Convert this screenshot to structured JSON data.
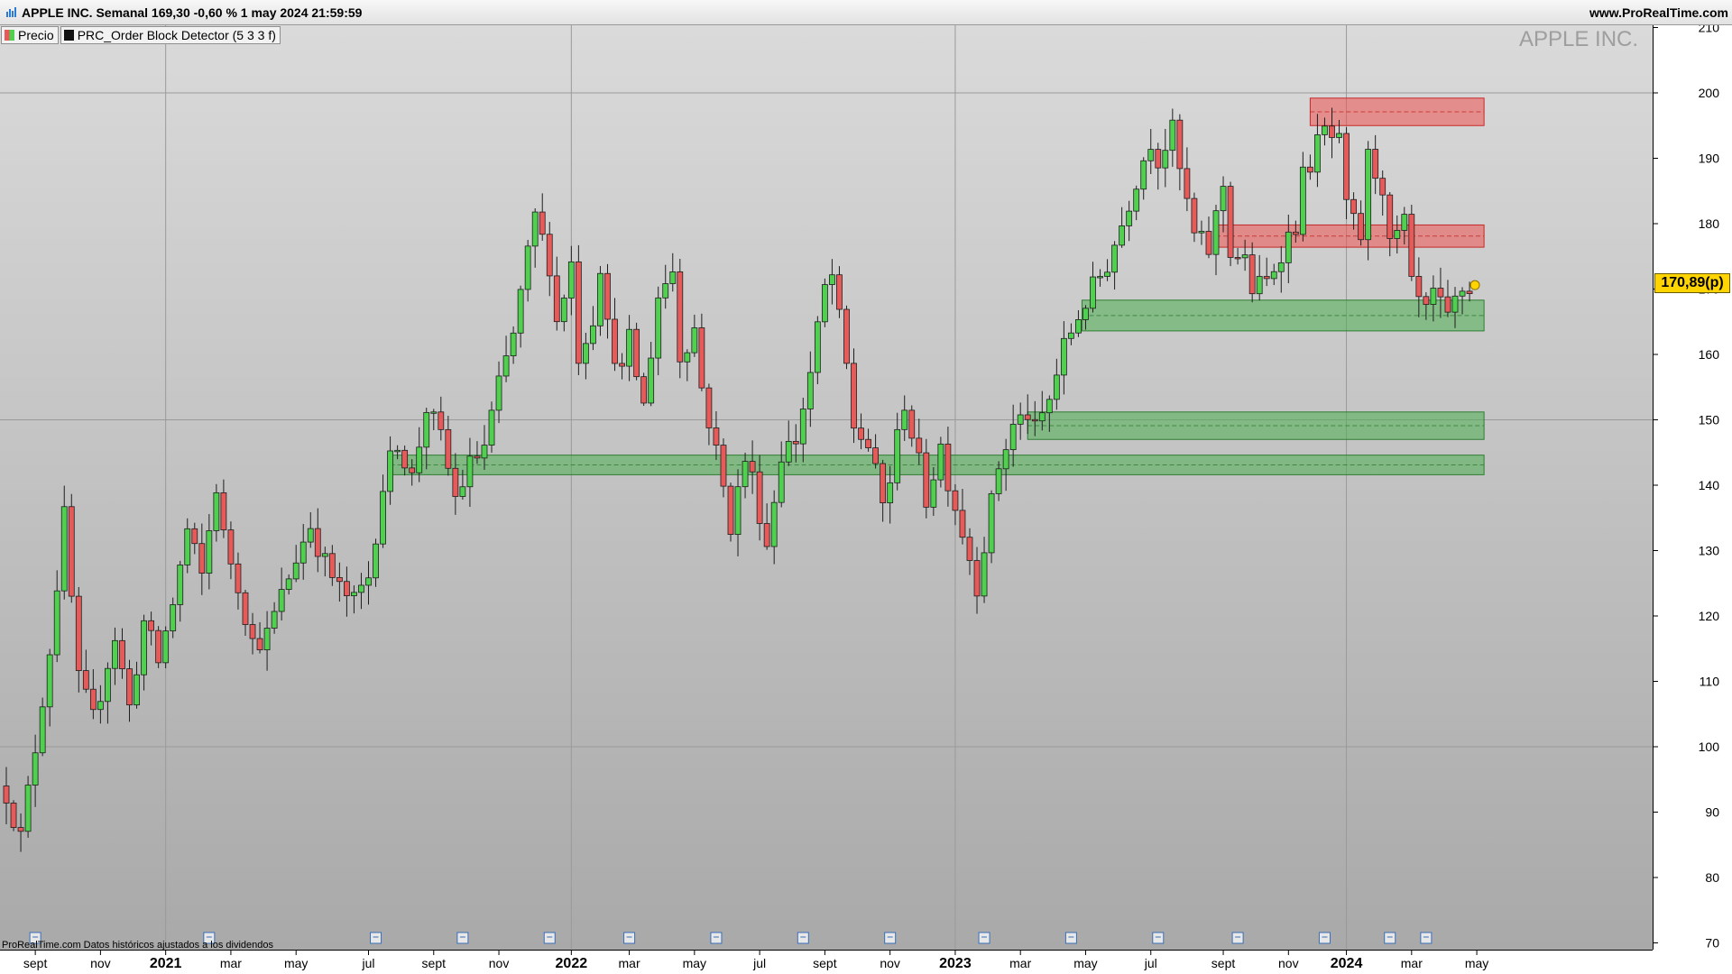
{
  "header": {
    "title": "APPLE INC. Semanal 169,30 -0,60 % 1 may 2024 21:59:59",
    "brand": "www.ProRealTime.com"
  },
  "legend": [
    {
      "label": "Precio",
      "color": "#4caf50"
    },
    {
      "label": "PRC_Order Block Detector (5 3 3 f)",
      "color": "#111111"
    }
  ],
  "watermark": "APPLE INC.",
  "footnote": "ProRealTime.com Datos históricos ajustados a los dividendos",
  "price_tag": "170,89(p)",
  "chart_data": {
    "type": "candlestick",
    "title": "APPLE INC. Semanal 169,30 -0,60 % 1 may 2024 21:59:59",
    "ylim": [
      68,
      212
    ],
    "y_ticks": [
      "210",
      "200",
      "190",
      "180",
      "170",
      "160",
      "150",
      "140",
      "130",
      "120",
      "110",
      "100",
      "90",
      "80",
      "70"
    ],
    "x_tick_labels": [
      {
        "t": 4,
        "label": "sept",
        "bold": false
      },
      {
        "t": 13,
        "label": "nov",
        "bold": false
      },
      {
        "t": 22,
        "label": "2021",
        "bold": true
      },
      {
        "t": 31,
        "label": "mar",
        "bold": false
      },
      {
        "t": 40,
        "label": "may",
        "bold": false
      },
      {
        "t": 50,
        "label": "jul",
        "bold": false
      },
      {
        "t": 59,
        "label": "sept",
        "bold": false
      },
      {
        "t": 68,
        "label": "nov",
        "bold": false
      },
      {
        "t": 78,
        "label": "2022",
        "bold": true
      },
      {
        "t": 86,
        "label": "mar",
        "bold": false
      },
      {
        "t": 95,
        "label": "may",
        "bold": false
      },
      {
        "t": 104,
        "label": "jul",
        "bold": false
      },
      {
        "t": 113,
        "label": "sept",
        "bold": false
      },
      {
        "t": 122,
        "label": "nov",
        "bold": false
      },
      {
        "t": 131,
        "label": "2023",
        "bold": true
      },
      {
        "t": 140,
        "label": "mar",
        "bold": false
      },
      {
        "t": 149,
        "label": "may",
        "bold": false
      },
      {
        "t": 158,
        "label": "jul",
        "bold": false
      },
      {
        "t": 168,
        "label": "sept",
        "bold": false
      },
      {
        "t": 177,
        "label": "nov",
        "bold": false
      },
      {
        "t": 185,
        "label": "2024",
        "bold": true
      },
      {
        "t": 194,
        "label": "mar",
        "bold": false
      },
      {
        "t": 203,
        "label": "may",
        "bold": false
      }
    ],
    "waypoints": [
      [
        0,
        93
      ],
      [
        2,
        86
      ],
      [
        4,
        100
      ],
      [
        6,
        115
      ],
      [
        8,
        135
      ],
      [
        10,
        110
      ],
      [
        12,
        104
      ],
      [
        14,
        113
      ],
      [
        15,
        117
      ],
      [
        17,
        106
      ],
      [
        19,
        119
      ],
      [
        21,
        113
      ],
      [
        23,
        122
      ],
      [
        25,
        133
      ],
      [
        27,
        126
      ],
      [
        29,
        140
      ],
      [
        30,
        132
      ],
      [
        32,
        125
      ],
      [
        34,
        116
      ],
      [
        36,
        117
      ],
      [
        38,
        123
      ],
      [
        40,
        129
      ],
      [
        42,
        134
      ],
      [
        44,
        128
      ],
      [
        46,
        124
      ],
      [
        48,
        122
      ],
      [
        50,
        126
      ],
      [
        52,
        140
      ],
      [
        54,
        147
      ],
      [
        56,
        141
      ],
      [
        58,
        152
      ],
      [
        60,
        147
      ],
      [
        62,
        138
      ],
      [
        64,
        143
      ],
      [
        66,
        146
      ],
      [
        68,
        155
      ],
      [
        70,
        163
      ],
      [
        72,
        175
      ],
      [
        73,
        181
      ],
      [
        75,
        174
      ],
      [
        76,
        165
      ],
      [
        78,
        174
      ],
      [
        79,
        160
      ],
      [
        81,
        166
      ],
      [
        82,
        174
      ],
      [
        83,
        164
      ],
      [
        85,
        157
      ],
      [
        86,
        162
      ],
      [
        88,
        152
      ],
      [
        90,
        169
      ],
      [
        92,
        173
      ],
      [
        93,
        160
      ],
      [
        95,
        164
      ],
      [
        96,
        155
      ],
      [
        98,
        145
      ],
      [
        100,
        134
      ],
      [
        102,
        144
      ],
      [
        103,
        141
      ],
      [
        105,
        131
      ],
      [
        107,
        145
      ],
      [
        109,
        147
      ],
      [
        111,
        157
      ],
      [
        113,
        170
      ],
      [
        114,
        172
      ],
      [
        116,
        158
      ],
      [
        117,
        149
      ],
      [
        119,
        146
      ],
      [
        121,
        137
      ],
      [
        122,
        141
      ],
      [
        124,
        153
      ],
      [
        125,
        148
      ],
      [
        127,
        138
      ],
      [
        129,
        146
      ],
      [
        130,
        141
      ],
      [
        132,
        133
      ],
      [
        134,
        125
      ],
      [
        135,
        131
      ],
      [
        137,
        143
      ],
      [
        139,
        149
      ],
      [
        141,
        151
      ],
      [
        142,
        148
      ],
      [
        144,
        153
      ],
      [
        145,
        157
      ],
      [
        146,
        161
      ],
      [
        148,
        166
      ],
      [
        150,
        170
      ],
      [
        152,
        174
      ],
      [
        154,
        180
      ],
      [
        156,
        187
      ],
      [
        158,
        193
      ],
      [
        159,
        190
      ],
      [
        161,
        194
      ],
      [
        162,
        188
      ],
      [
        164,
        178
      ],
      [
        166,
        176
      ],
      [
        168,
        186
      ],
      [
        169,
        176
      ],
      [
        171,
        174
      ],
      [
        172,
        170
      ],
      [
        174,
        171
      ],
      [
        176,
        176
      ],
      [
        178,
        180
      ],
      [
        179,
        187
      ],
      [
        181,
        192
      ],
      [
        182,
        194
      ],
      [
        184,
        192
      ],
      [
        185,
        182
      ],
      [
        187,
        178
      ],
      [
        188,
        190
      ],
      [
        190,
        186
      ],
      [
        191,
        176
      ],
      [
        193,
        180
      ],
      [
        194,
        170
      ],
      [
        196,
        166
      ],
      [
        197,
        169
      ],
      [
        199,
        165
      ],
      [
        200,
        168
      ],
      [
        201,
        170
      ],
      [
        202,
        169.3
      ]
    ],
    "order_blocks": [
      {
        "type": "bearish",
        "start": 180,
        "end": 204,
        "high": 199.2,
        "low": 195.0
      },
      {
        "type": "bearish",
        "start": 167,
        "end": 204,
        "high": 179.8,
        "low": 176.4
      },
      {
        "type": "bullish",
        "start": 148.5,
        "end": 204,
        "high": 168.3,
        "low": 163.6
      },
      {
        "type": "bullish",
        "start": 141,
        "end": 204,
        "high": 151.2,
        "low": 147.0
      },
      {
        "type": "bullish",
        "start": 53,
        "end": 204,
        "high": 144.6,
        "low": 141.6
      }
    ],
    "last_price": 170.89,
    "grid": true,
    "colors": {
      "up": "#4fd14f",
      "down": "#e65a5a",
      "bull_block": "#4caf50",
      "bear_block": "#ef5350",
      "bg_top": "#dadada",
      "bg_bottom": "#a9a9a9",
      "price_tag": "#ffd400"
    }
  }
}
